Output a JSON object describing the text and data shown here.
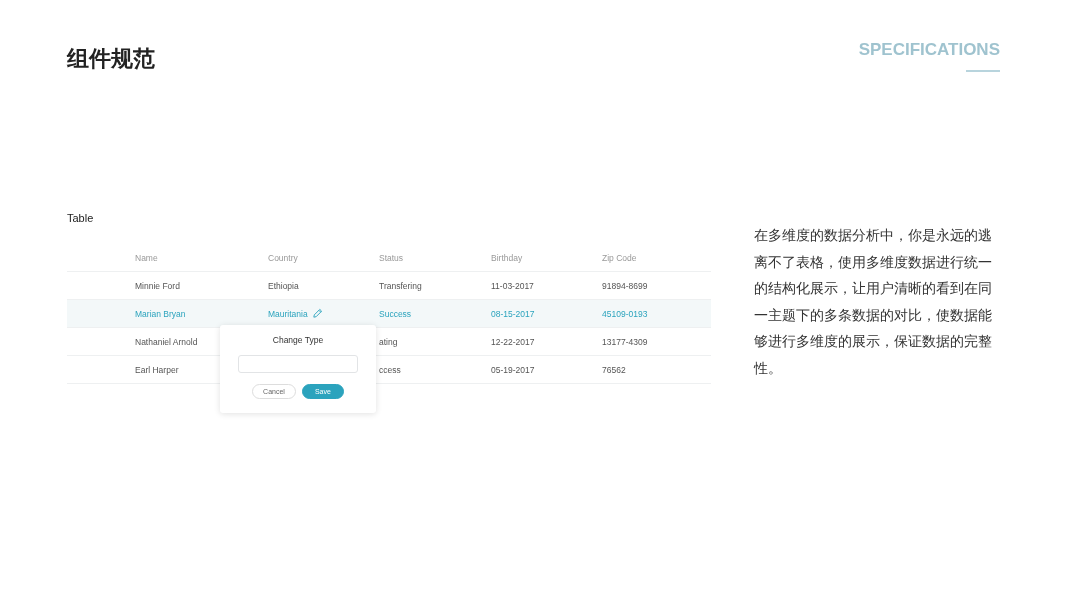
{
  "page": {
    "title": "组件规范",
    "tag": "SPECIFICATIONS"
  },
  "section": {
    "title": "Table"
  },
  "table": {
    "columns": [
      "Name",
      "Country",
      "Status",
      "Birthday",
      "Zip Code"
    ],
    "rows": [
      {
        "cells": [
          "Minnie Ford",
          "Ethiopia",
          "Transfering",
          "11-03-2017",
          "91894-8699"
        ],
        "selected": false,
        "editable": false
      },
      {
        "cells": [
          "Marian Bryan",
          "Mauritania",
          "Success",
          "08-15-2017",
          "45109-0193"
        ],
        "selected": true,
        "editable": true
      },
      {
        "cells": [
          "Nathaniel Arnold",
          "",
          "ating",
          "12-22-2017",
          "13177-4309"
        ],
        "selected": false,
        "editable": false
      },
      {
        "cells": [
          "Earl Harper",
          "",
          "ccess",
          "05-19-2017",
          "76562"
        ],
        "selected": false,
        "editable": false
      }
    ]
  },
  "popover": {
    "title": "Change Type",
    "buttons": [
      {
        "label": "Cancel",
        "kind": "secondary"
      },
      {
        "label": "Save",
        "kind": "primary"
      }
    ]
  },
  "description": "在多维度的数据分析中，你是永远的逃离不了表格，使用多维度数据进行统一的结构化展示，让用户清晰的看到在同一主题下的多条数据的对比，使数据能够进行多维度的展示，保证数据的完整性。"
}
